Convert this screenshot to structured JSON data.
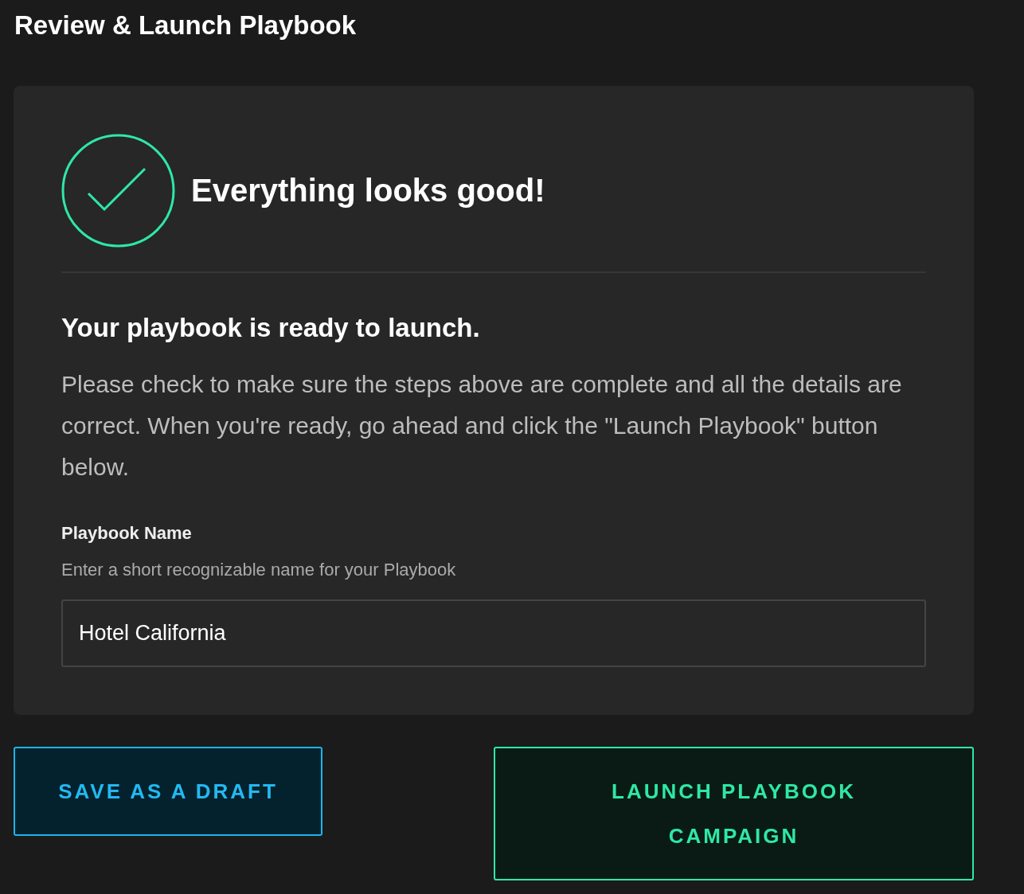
{
  "title": "Review & Launch Playbook",
  "status": {
    "heading": "Everything looks good!"
  },
  "message": {
    "heading": "Your playbook is ready to launch.",
    "body": "Please check to make sure the steps above are complete and all the details are correct. When you're ready, go ahead and click the \"Launch Playbook\" button below."
  },
  "name_field": {
    "label": "Playbook Name",
    "hint": "Enter a short recognizable name for your Playbook",
    "value": "Hotel California"
  },
  "buttons": [
    {
      "label": "SAVE AS A DRAFT",
      "kind": "secondary"
    },
    {
      "label": "LAUNCH PLAYBOOK CAMPAIGN",
      "kind": "primary"
    }
  ]
}
